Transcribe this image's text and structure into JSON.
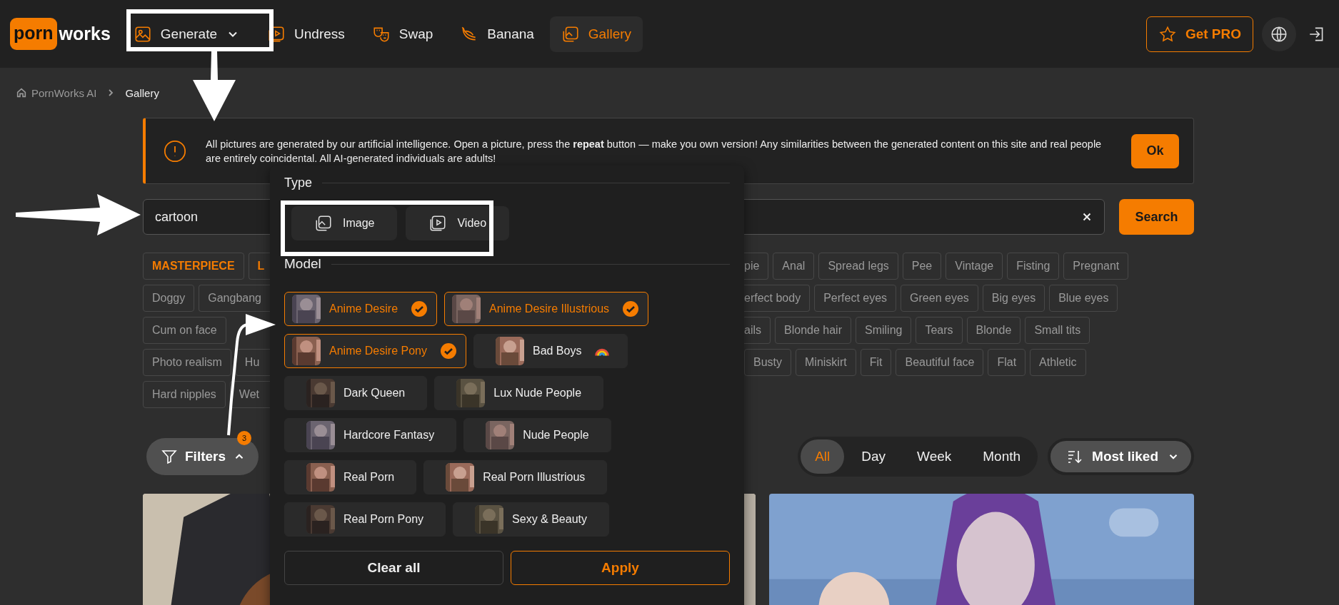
{
  "nav": {
    "logo": {
      "part1": "porn",
      "part2": "works"
    },
    "items": [
      {
        "label": "Generate",
        "selected": false,
        "dropdown": true
      },
      {
        "label": "Undress",
        "selected": false,
        "dropdown": false
      },
      {
        "label": "Swap",
        "selected": false,
        "dropdown": false
      },
      {
        "label": "Banana",
        "selected": false,
        "dropdown": false
      },
      {
        "label": "Gallery",
        "selected": true,
        "dropdown": false
      }
    ],
    "pro_button": "Get PRO"
  },
  "breadcrumb": [
    "PornWorks AI",
    "Gallery"
  ],
  "notice": {
    "text": "All pictures are generated by our artificial intelligence. Open a picture, press the **repeat** button — make you own version! Any similarities between the generated content on this site and real people are entirely coincidental. All AI-generated individuals are adults!",
    "button": "Ok"
  },
  "search": {
    "value": "cartoon",
    "button": "Search"
  },
  "tags": [
    {
      "left": [
        {
          "label": "MASTERPIECE",
          "kind": "featured",
          "cut": false
        },
        {
          "label": "L",
          "kind": "featured",
          "cut": true
        }
      ],
      "right": [
        {
          "label": "pie",
          "kind": "plain",
          "cut": true
        },
        {
          "label": "Anal",
          "kind": "plain",
          "cut": false
        },
        {
          "label": "Spread legs",
          "kind": "plain",
          "cut": false
        },
        {
          "label": "Pee",
          "kind": "plain",
          "cut": false
        },
        {
          "label": "Vintage",
          "kind": "plain",
          "cut": false
        },
        {
          "label": "Fisting",
          "kind": "plain",
          "cut": false
        },
        {
          "label": "Pregnant",
          "kind": "plain",
          "cut": false
        }
      ]
    },
    {
      "left": [
        {
          "label": "Doggy",
          "kind": "plain",
          "cut": false
        },
        {
          "label": "Gangbang",
          "kind": "plain",
          "cut": true
        }
      ],
      "right": [
        {
          "label": "erfect body",
          "kind": "plain",
          "cut": true
        },
        {
          "label": "Perfect eyes",
          "kind": "plain",
          "cut": false
        },
        {
          "label": "Green eyes",
          "kind": "plain",
          "cut": false
        },
        {
          "label": "Big eyes",
          "kind": "plain",
          "cut": false
        },
        {
          "label": "Blue eyes",
          "kind": "plain",
          "cut": false
        }
      ]
    },
    {
      "left": [
        {
          "label": "Cum on face",
          "kind": "plain",
          "cut": false
        }
      ],
      "right": [
        {
          "label": "ails",
          "kind": "plain",
          "cut": true
        },
        {
          "label": "Blonde hair",
          "kind": "plain",
          "cut": false
        },
        {
          "label": "Smiling",
          "kind": "plain",
          "cut": false
        },
        {
          "label": "Tears",
          "kind": "plain",
          "cut": false
        },
        {
          "label": "Blonde",
          "kind": "plain",
          "cut": false
        },
        {
          "label": "Small tits",
          "kind": "plain",
          "cut": false
        }
      ]
    },
    {
      "left": [
        {
          "label": "Photo realism",
          "kind": "plain",
          "cut": false
        },
        {
          "label": "Hu",
          "kind": "plain",
          "cut": true
        }
      ],
      "right": [
        {
          "label": "Busty",
          "kind": "plain",
          "cut": false
        },
        {
          "label": "Miniskirt",
          "kind": "plain",
          "cut": false
        },
        {
          "label": "Fit",
          "kind": "plain",
          "cut": false
        },
        {
          "label": "Beautiful face",
          "kind": "plain",
          "cut": false
        },
        {
          "label": "Flat",
          "kind": "plain",
          "cut": false
        },
        {
          "label": "Athletic",
          "kind": "plain",
          "cut": false
        }
      ]
    },
    {
      "left": [
        {
          "label": "Hard nipples",
          "kind": "plain",
          "cut": false
        },
        {
          "label": "Wet",
          "kind": "plain",
          "cut": true
        }
      ]
    }
  ],
  "filters": {
    "label": "Filters",
    "badge": "3",
    "expanded": true
  },
  "periods": [
    {
      "label": "All",
      "selected": true
    },
    {
      "label": "Day",
      "selected": false
    },
    {
      "label": "Week",
      "selected": false
    },
    {
      "label": "Month",
      "selected": false
    }
  ],
  "sort": {
    "label": "Most liked"
  },
  "panel": {
    "type_heading": "Type",
    "types": [
      {
        "label": "Image",
        "selected": false
      },
      {
        "label": "Video",
        "selected": false
      }
    ],
    "model_heading": "Model",
    "models": [
      {
        "name": "Anime Desire",
        "selected": true,
        "has_badge": false
      },
      {
        "name": "Anime Desire Illustrious",
        "selected": true,
        "has_badge": false
      },
      {
        "name": "Anime Desire Pony",
        "selected": true,
        "has_badge": false
      },
      {
        "name": "Bad Boys",
        "selected": false,
        "has_badge": true
      },
      {
        "name": "Dark Queen",
        "selected": false,
        "has_badge": false
      },
      {
        "name": "Lux Nude People",
        "selected": false,
        "has_badge": false
      },
      {
        "name": "Hardcore Fantasy",
        "selected": false,
        "has_badge": false
      },
      {
        "name": "Nude People",
        "selected": false,
        "has_badge": false
      },
      {
        "name": "Real Porn",
        "selected": false,
        "has_badge": false
      },
      {
        "name": "Real Porn Illustrious",
        "selected": false,
        "has_badge": false
      },
      {
        "name": "Real Porn Pony",
        "selected": false,
        "has_badge": false
      },
      {
        "name": "Sexy & Beauty",
        "selected": false,
        "has_badge": false
      }
    ],
    "clear": "Clear all",
    "apply": "Apply"
  }
}
